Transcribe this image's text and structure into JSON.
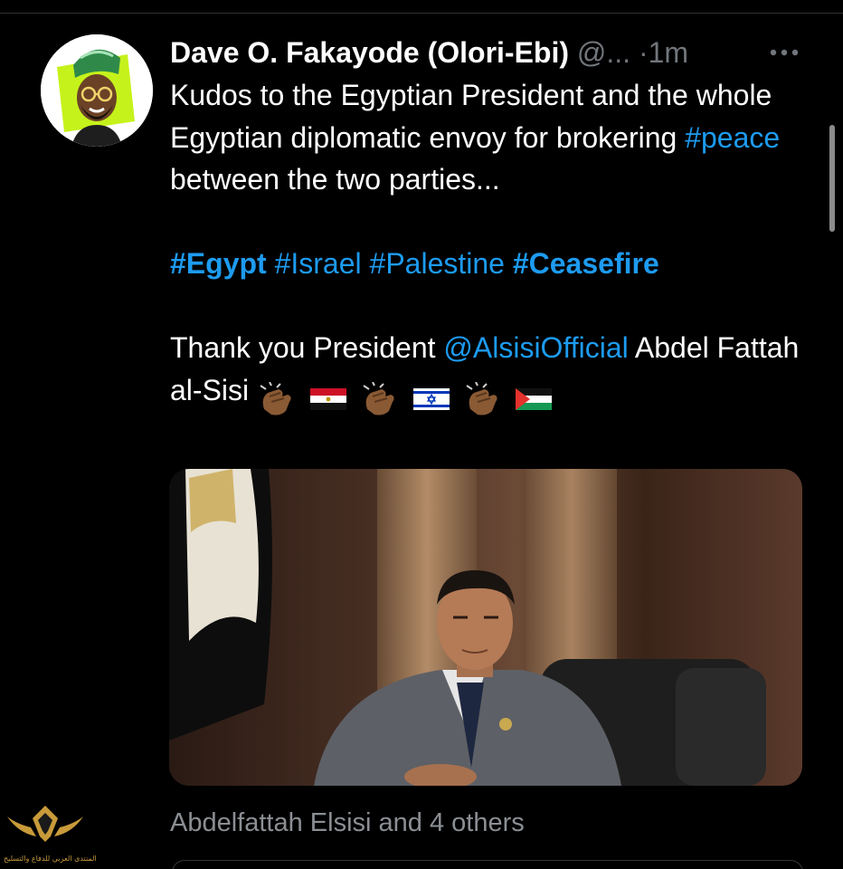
{
  "tweet": {
    "author_name": "Dave O. Fakayode (Olori-Ebi)",
    "author_handle": "@...",
    "separator": "·",
    "timestamp": "1m",
    "text_line1": "Kudos to the Egyptian President and the whole Egyptian diplomatic envoy for brokering ",
    "hashtag_peace": "#peace",
    "text_line1_end": " between the two parties...",
    "hashtags": [
      "#Egypt",
      "#Israel",
      "#Palestine",
      "#Ceasefire"
    ],
    "thanks_prefix": "Thank you President ",
    "mention": "@AlsisiOfficial",
    "thanks_suffix": " Abdel Fattah al-Sisi",
    "emojis": [
      "clapping-hands-icon",
      "egypt-flag-icon",
      "clapping-hands-icon",
      "israel-flag-icon",
      "clapping-hands-icon",
      "palestine-flag-icon"
    ],
    "liked_by": "Abdelfattah Elsisi and 4 others"
  },
  "watermark": {
    "text": "المنتدى العربي للدفاع والتسليح"
  },
  "colors": {
    "background": "#000000",
    "link": "#1d9bf0",
    "muted": "#71767b",
    "text": "#ffffff"
  }
}
